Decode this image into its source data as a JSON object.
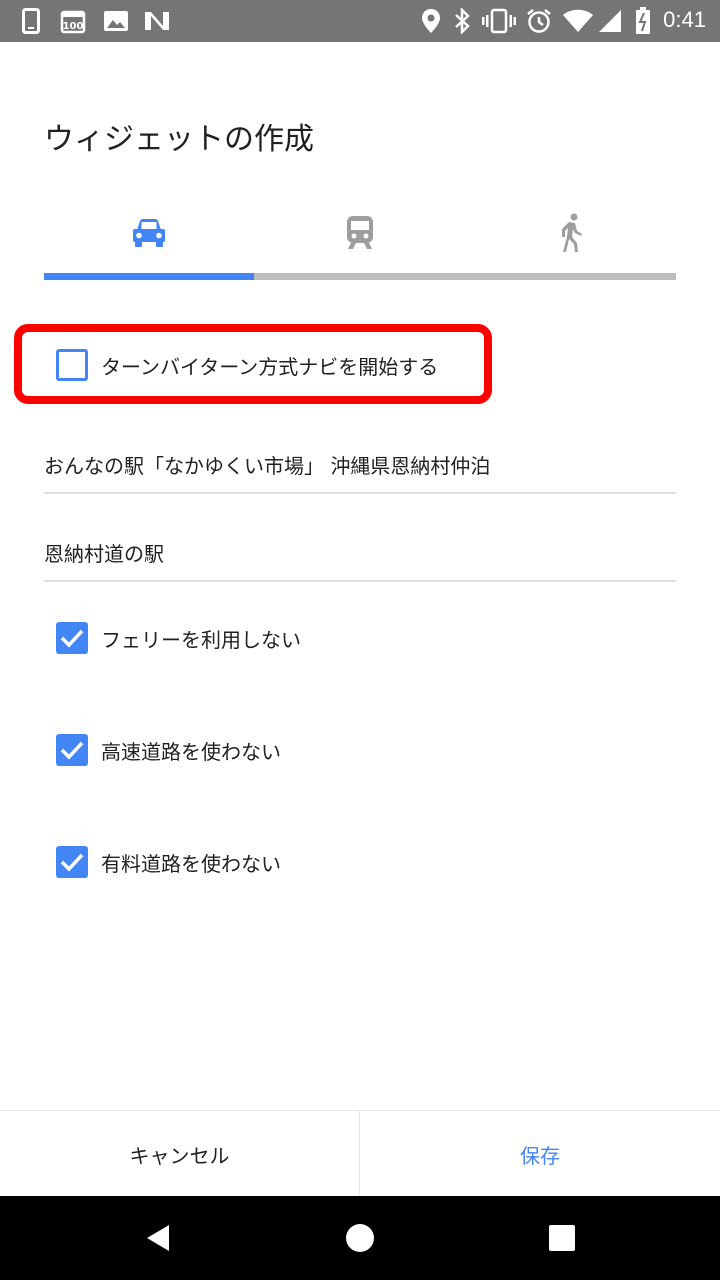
{
  "status_bar": {
    "time": "0:41",
    "left_icons": [
      "phone-icon",
      "calendar-100-icon",
      "image-icon",
      "n-logo-icon"
    ],
    "right_icons": [
      "location-icon",
      "bluetooth-icon",
      "vibrate-icon",
      "alarm-icon",
      "wifi-icon",
      "signal-icon",
      "battery-icon"
    ]
  },
  "dialog": {
    "title": "ウィジェットの作成",
    "tabs": [
      {
        "name": "car",
        "icon": "car-icon",
        "selected": true
      },
      {
        "name": "transit",
        "icon": "train-icon",
        "selected": false
      },
      {
        "name": "walk",
        "icon": "walk-icon",
        "selected": false
      }
    ],
    "turn_by_turn": {
      "label": "ターンバイターン方式ナビを開始する",
      "checked": false
    },
    "destination": "おんなの駅「なかゆくい市場」 沖縄県恩納村仲泊",
    "widget_name": "恩納村道の駅",
    "options": [
      {
        "label": "フェリーを利用しない",
        "checked": true
      },
      {
        "label": "高速道路を使わない",
        "checked": true
      },
      {
        "label": "有料道路を使わない",
        "checked": true
      }
    ],
    "cancel_label": "キャンセル",
    "save_label": "保存"
  },
  "colors": {
    "accent": "#4285f4",
    "highlight": "#ff0000",
    "status_bar": "#757575",
    "nav_bar": "#000000",
    "inactive_icon": "#9e9e9e"
  }
}
